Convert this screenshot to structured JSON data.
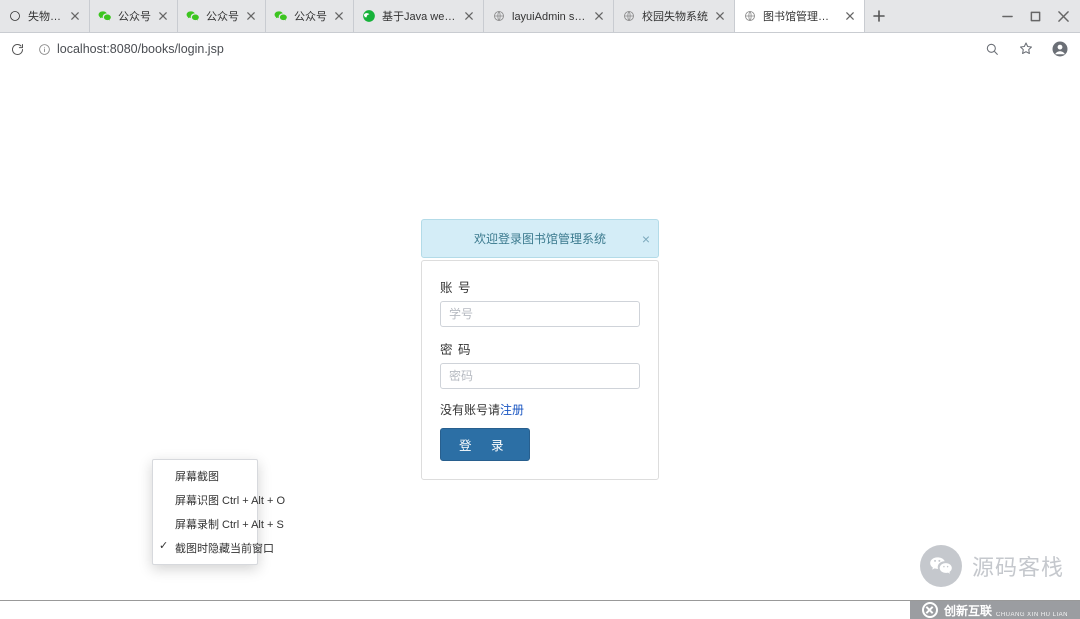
{
  "browser": {
    "tabs": [
      {
        "favicon": "generic",
        "title": "失物系统"
      },
      {
        "favicon": "wechat-green",
        "title": "公众号"
      },
      {
        "favicon": "wechat-green",
        "title": "公众号"
      },
      {
        "favicon": "wechat-green",
        "title": "公众号"
      },
      {
        "favicon": "wechat-solid",
        "title": "基于Java web的投票管理系"
      },
      {
        "favicon": "globe",
        "title": "layuiAdmin std - 通用后"
      },
      {
        "favicon": "globe",
        "title": "校园失物系统"
      },
      {
        "favicon": "globe",
        "title": "图书馆管理系统"
      }
    ],
    "active_tab_index": 7,
    "url_display": "localhost:8080/books/login.jsp"
  },
  "login": {
    "alert_text": "欢迎登录图书馆管理系统",
    "username_label": "账 号",
    "username_placeholder": "学号",
    "password_label": "密 码",
    "password_placeholder": "密码",
    "no_account_prefix": "没有账号请",
    "register_link_text": "注册",
    "submit_label": "登   录"
  },
  "context_menu": {
    "items": [
      {
        "label": "屏幕截图",
        "checked": false
      },
      {
        "label": "屏幕识图 Ctrl + Alt + O",
        "checked": false
      },
      {
        "label": "屏幕录制 Ctrl + Alt + S",
        "checked": false
      },
      {
        "label": "截图时隐藏当前窗口",
        "checked": true
      }
    ]
  },
  "watermark": {
    "wechat_text": "源码客栈"
  },
  "footer_logo": {
    "text": "创新互联",
    "sub": "CHUANG XIN HU LIAN"
  }
}
